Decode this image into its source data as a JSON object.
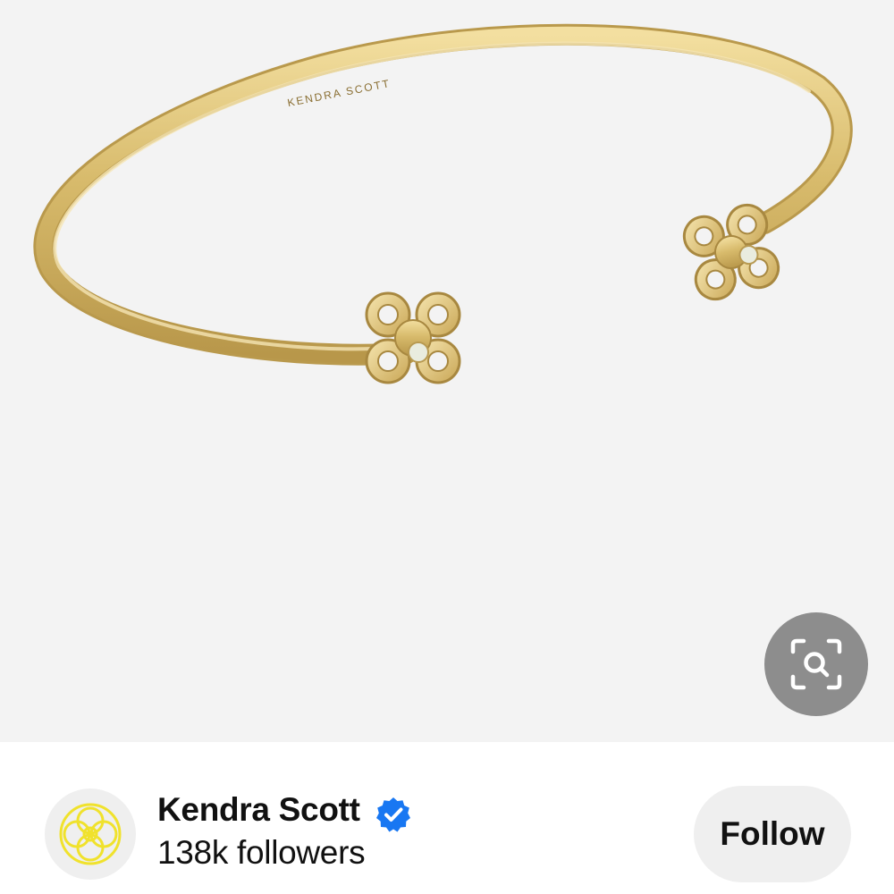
{
  "pin": {
    "image_alt": "Gold open cuff bracelet with flower motif ends",
    "engraving": "KENDRA SCOTT"
  },
  "visual_search": {
    "icon": "visual-search-icon"
  },
  "creator": {
    "name": "Kendra Scott",
    "verified": true,
    "followers": "138k followers",
    "follow_label": "Follow",
    "avatar_icon": "kendra-scott-logo-icon"
  },
  "colors": {
    "image_bg": "#f3f3f3",
    "gold": "#d9bd6e",
    "verified_blue": "#1877f2",
    "button_bg": "#efefef",
    "logo_yellow": "#f2e63a"
  }
}
